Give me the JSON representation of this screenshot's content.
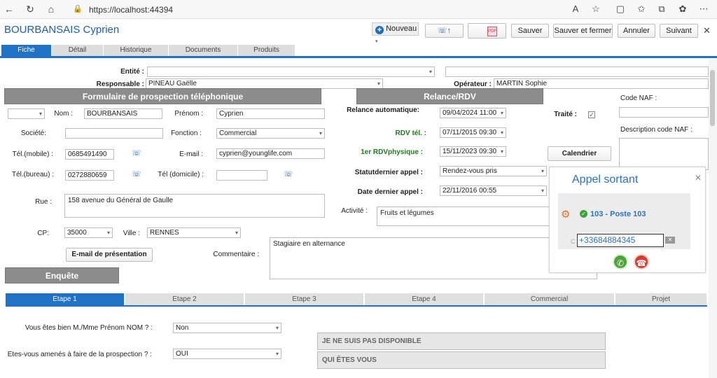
{
  "browser": {
    "url": "https://localhost:44394",
    "icons": [
      "back-icon",
      "reload-icon",
      "home-icon",
      "lock-icon",
      "read-aloud-icon",
      "favorite-icon",
      "split-screen-icon",
      "favorites-icon",
      "collections-icon",
      "extensions-icon"
    ]
  },
  "header": {
    "title": "BOURBANSAIS Cyprien",
    "nouveau": "Nouveau",
    "pdf_label": "PDF",
    "buttons": {
      "sauver": "Sauver",
      "sauver_fermer": "Sauver et fermer",
      "annuler": "Annuler",
      "suivant": "Suivant"
    }
  },
  "tabs": [
    "Fiche",
    "Détail",
    "Historique",
    "Documents",
    "Produits"
  ],
  "top": {
    "entite_label": "Entité :",
    "responsable_label": "Responsable :",
    "responsable_value": "PINEAU Gaëlle",
    "operateur_label": "Opérateur :",
    "operateur_value": "MARTIN Sophie"
  },
  "sections": {
    "prospection": "Formulaire de prospection téléphonique",
    "relance": "Relance/RDV",
    "enquete": "Enquête"
  },
  "contact": {
    "nom_label": "Nom :",
    "nom": "BOURBANSAIS",
    "prenom_label": "Prénom :",
    "prenom": "Cyprien",
    "societe_label": "Société:",
    "fonction_label": "Fonction :",
    "fonction": "Commercial",
    "tel_mobile_label": "Tél.(mobile) :",
    "tel_mobile": "0685491490",
    "email_label": "E-mail :",
    "email": "cyprien@younglife.com",
    "tel_bureau_label": "Tél.(bureau) :",
    "tel_bureau": "0272880659",
    "tel_domicile_label": "Tél (domicile) :",
    "rue_label": "Rue :",
    "rue": "158 avenue du Général de Gaulle",
    "cp_label": "CP:",
    "cp": "35000",
    "ville_label": "Ville :",
    "ville": "RENNES",
    "email_presentation": "E-mail de présentation",
    "commentaire_label": "Commentaire :",
    "commentaire": "Stagiaire en alternance"
  },
  "relance": {
    "auto_label": "Relance automatique:",
    "auto": "09/04/2024 11:00",
    "rdv_tel_label": "RDV tél. :",
    "rdv_tel": "07/11/2015 09:30",
    "rdv_phys_label": "1er RDVphysique :",
    "rdv_phys": "15/11/2023 09:30",
    "statut_label": "Statutdernier appel :",
    "statut": "Rendez-vous pris",
    "date_label": "Date dernier appel :",
    "date": "22/11/2016 00:55",
    "activite_label": "Activité :",
    "activite": "Fruits et légumes",
    "traite_label": "Traité :",
    "calendrier": "Calendrier"
  },
  "naf": {
    "code_label": "Code NAF :",
    "desc_label": "Description code NAF :"
  },
  "steps": [
    "Etape 1",
    "Etape 2",
    "Etape 3",
    "Etape 4",
    "Commercial",
    "Projet"
  ],
  "questions": {
    "q1_label": "Vous êtes bien M./Mme Prénom NOM ? :",
    "q1": "Non",
    "q2_label": "Etes-vous amenés à faire de la prospection ? :",
    "q2": "OUI",
    "btn1": "JE NE SUIS PAS DISPONIBLE",
    "btn2": "QUI ÊTES VOUS"
  },
  "popup": {
    "title": "Appel sortant",
    "poste": "103 - Poste 103",
    "number": "+33684884345",
    "c_label": "C"
  }
}
